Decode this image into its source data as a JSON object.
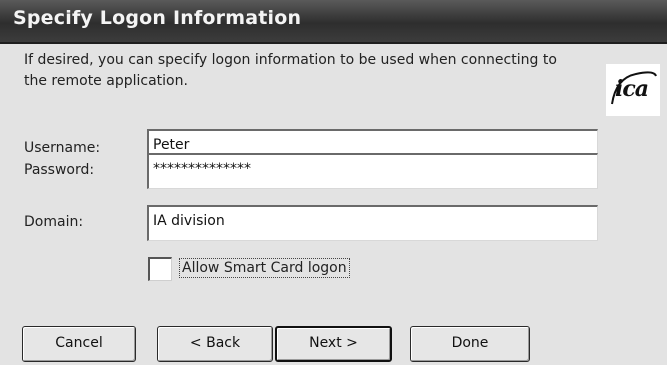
{
  "dialog": {
    "title": "Specify Logon Information",
    "description": "If desired, you can specify logon information to be used when connecting to the remote application.",
    "logo_text": "ica"
  },
  "fields": {
    "username": {
      "label": "Username:",
      "value": "Peter"
    },
    "password": {
      "label": "Password:",
      "value": "**************"
    },
    "domain": {
      "label": "Domain:",
      "value": "IA division"
    }
  },
  "smart_card": {
    "label": "Allow Smart Card logon",
    "checked": false
  },
  "buttons": {
    "cancel": "Cancel",
    "back": "< Back",
    "next": "Next >",
    "done": "Done"
  }
}
